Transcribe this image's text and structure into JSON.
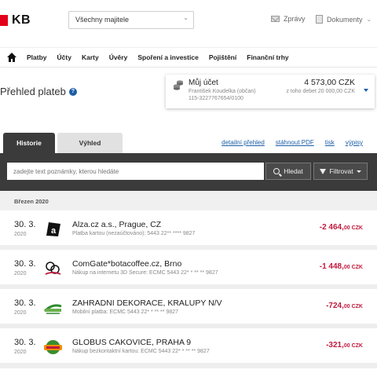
{
  "brand": {
    "name": "KB",
    "color": "#e2001a"
  },
  "header": {
    "owner_select": "Všechny majitele",
    "messages": "Zprávy",
    "documents": "Dokumenty"
  },
  "nav": {
    "items": [
      "Platby",
      "Účty",
      "Karty",
      "Úvěry",
      "Spoření a investice",
      "Pojištění",
      "Finanční trhy"
    ]
  },
  "page": {
    "title": "Přehled plateb",
    "help": "?"
  },
  "account": {
    "name": "Můj účet",
    "owner": "František Koudelka (občan)",
    "number": "115-3227767654/0100",
    "balance": "4 573,00 CZK",
    "debt": "z toho debet 20 000,00 CZK"
  },
  "tabs": [
    "Historie",
    "Výhled"
  ],
  "actions": [
    "detailní přehled",
    "stáhnout PDF",
    "tisk",
    "výpisy"
  ],
  "search": {
    "placeholder": "zadejte text poznámky, kterou hledáte",
    "search_label": "Hledat",
    "filter_label": "Filtrovat"
  },
  "month": "Březen 2020",
  "transactions": [
    {
      "day": "30. 3.",
      "year": "2020",
      "logo": "alza-logo",
      "name": "Alza.cz a.s., Prague, CZ",
      "desc": "Platba kartou (nezaúčtováno): 5443 22** **** 9827",
      "amount": "-2 464,",
      "cents": "00 CZK"
    },
    {
      "day": "30. 3.",
      "year": "2020",
      "logo": "comgate-logo",
      "name": "ComGate*botacoffee.cz, Brno",
      "desc": "Nákup na internetu 3D Secure: ECMC 5443 22* * ** ** 9827",
      "amount": "-1 448,",
      "cents": "00 CZK"
    },
    {
      "day": "30. 3.",
      "year": "2020",
      "logo": "garden-logo",
      "name": "ZAHRADNI DEKORACE, KRALUPY N/V",
      "desc": "Mobilní platba: ECMC 5443 22* * ** ** 9827",
      "amount": "-724,",
      "cents": "00 CZK"
    },
    {
      "day": "30. 3.",
      "year": "2020",
      "logo": "globus-logo",
      "name": "GLOBUS CAKOVICE, PRAHA 9",
      "desc": "Nákup bezkontaktní kartou: ECMC 5443 22* * ** ** 9827",
      "amount": "-321,",
      "cents": "00 CZK"
    }
  ],
  "colors": {
    "accent": "#1d5fa6",
    "negative": "#c0193d",
    "dark_bar": "#3b3b3b"
  }
}
